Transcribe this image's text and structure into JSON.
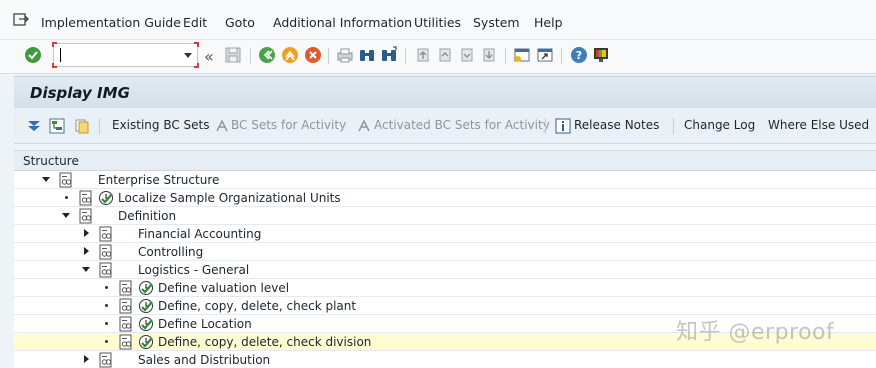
{
  "menubar": {
    "items": [
      "Implementation Guide",
      "Edit",
      "Goto",
      "Additional Information",
      "Utilities",
      "System",
      "Help"
    ]
  },
  "toolbar": {
    "command_field_value": "",
    "icons": [
      "enter-icon",
      "save-icon",
      "back-icon",
      "exit-icon",
      "cancel-icon",
      "print-icon",
      "find-icon",
      "find-next-icon",
      "first-page-icon",
      "prev-page-icon",
      "next-page-icon",
      "last-page-icon",
      "create-session-icon",
      "shortcut-icon",
      "help-icon",
      "customize-layout-icon"
    ]
  },
  "title": "Display IMG",
  "app_toolbar": {
    "existing_bc_sets": "Existing BC Sets",
    "bc_sets_for_activity": "BC Sets for Activity",
    "activated_bc_sets": "Activated BC Sets for Activity",
    "release_notes": "Release Notes",
    "change_log": "Change Log",
    "where_else_used": "Where Else Used"
  },
  "tree": {
    "header": "Structure",
    "rows": [
      {
        "label": "Enterprise Structure",
        "level": 0,
        "state": "expanded",
        "activity": false,
        "highlight": false
      },
      {
        "label": "Localize Sample Organizational Units",
        "level": 1,
        "state": "leaf",
        "activity": true,
        "highlight": false
      },
      {
        "label": "Definition",
        "level": 1,
        "state": "expanded",
        "activity": false,
        "highlight": false
      },
      {
        "label": "Financial Accounting",
        "level": 2,
        "state": "collapsed",
        "activity": false,
        "highlight": false
      },
      {
        "label": "Controlling",
        "level": 2,
        "state": "collapsed",
        "activity": false,
        "highlight": false
      },
      {
        "label": "Logistics - General",
        "level": 2,
        "state": "expanded",
        "activity": false,
        "highlight": false
      },
      {
        "label": "Define valuation level",
        "level": 3,
        "state": "leaf",
        "activity": true,
        "highlight": false
      },
      {
        "label": "Define, copy, delete, check plant",
        "level": 3,
        "state": "leaf",
        "activity": true,
        "highlight": false
      },
      {
        "label": "Define Location",
        "level": 3,
        "state": "leaf",
        "activity": true,
        "highlight": false
      },
      {
        "label": "Define, copy, delete, check division",
        "level": 3,
        "state": "leaf",
        "activity": true,
        "highlight": true
      },
      {
        "label": "Sales and Distribution",
        "level": 2,
        "state": "collapsed",
        "activity": false,
        "highlight": false
      }
    ]
  },
  "watermark": "知乎 @erproof",
  "colors": {
    "highlight_row": "#fdfcd3",
    "title_bg": "#d9e4ed",
    "activity_green": "#2e8b3a"
  }
}
